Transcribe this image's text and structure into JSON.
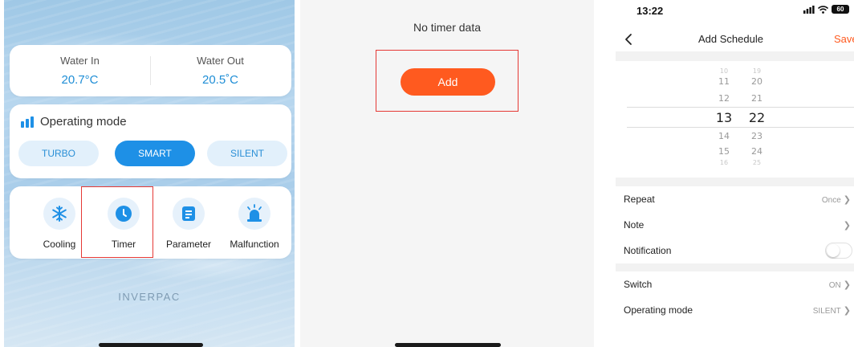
{
  "panel_home": {
    "water": {
      "in_label": "Water In",
      "in_value": "20.7°C",
      "out_label": "Water Out",
      "out_value": "20.5˚C"
    },
    "mode": {
      "title": "Operating mode",
      "options": [
        "TURBO",
        "SMART",
        "SILENT"
      ],
      "selected": "SMART"
    },
    "functions": [
      {
        "label": "Cooling",
        "icon": "snowflake-icon"
      },
      {
        "label": "Timer",
        "icon": "clock-icon"
      },
      {
        "label": "Parameter",
        "icon": "document-icon"
      },
      {
        "label": "Malfunction",
        "icon": "alarm-light-icon"
      }
    ],
    "brand": "INVERPAC"
  },
  "panel_timer": {
    "empty_text": "No timer data",
    "add_label": "Add"
  },
  "panel_schedule": {
    "status_time": "13:22",
    "battery": "60",
    "title": "Add Schedule",
    "save_label": "Save",
    "picker": {
      "hours": [
        "10",
        "11",
        "12",
        "13",
        "14",
        "15",
        "16"
      ],
      "minutes": [
        "19",
        "20",
        "21",
        "22",
        "23",
        "24",
        "25"
      ],
      "selected_hour": "13",
      "selected_minute": "22"
    },
    "rows": {
      "repeat_label": "Repeat",
      "repeat_value": "Once",
      "note_label": "Note",
      "notification_label": "Notification",
      "notification_on": false,
      "switch_label": "Switch",
      "switch_value": "ON",
      "opmode_label": "Operating mode",
      "opmode_value": "SILENT"
    }
  },
  "colors": {
    "primary_blue": "#1e90e6",
    "accent_orange": "#ff5a1f",
    "highlight_red": "#e53935"
  }
}
